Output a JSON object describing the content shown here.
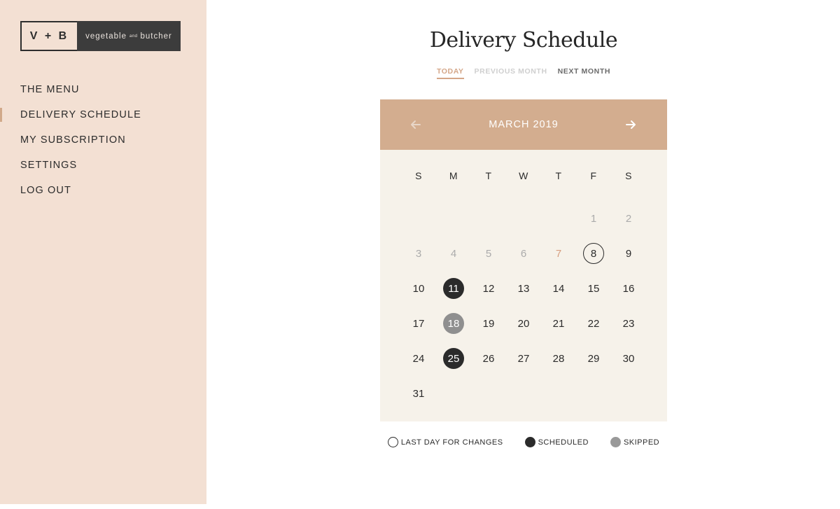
{
  "logo": {
    "mark": "V + B",
    "text_left": "vegetable",
    "text_and": "and",
    "text_right": "butcher"
  },
  "sidebar": {
    "items": [
      {
        "label": "THE MENU"
      },
      {
        "label": "DELIVERY SCHEDULE"
      },
      {
        "label": "MY SUBSCRIPTION"
      },
      {
        "label": "SETTINGS"
      },
      {
        "label": "LOG OUT"
      }
    ]
  },
  "page": {
    "title": "Delivery Schedule"
  },
  "subnav": {
    "today": "TODAY",
    "previous": "PREVIOUS MONTH",
    "next": "NEXT MONTH"
  },
  "calendar": {
    "month": "MARCH 2019",
    "prev_icon": "arrow-left-icon",
    "next_icon": "arrow-right-icon",
    "weekdays": [
      "S",
      "M",
      "T",
      "W",
      "T",
      "F",
      "S"
    ],
    "weeks": [
      [
        "",
        "",
        "",
        "",
        "",
        "1",
        "2"
      ],
      [
        "3",
        "4",
        "5",
        "6",
        "7",
        "8",
        "9"
      ],
      [
        "10",
        "11",
        "12",
        "13",
        "14",
        "15",
        "16"
      ],
      [
        "17",
        "18",
        "19",
        "20",
        "21",
        "22",
        "23"
      ],
      [
        "24",
        "25",
        "26",
        "27",
        "28",
        "29",
        "30"
      ],
      [
        "31",
        "",
        "",
        "",
        "",
        "",
        ""
      ]
    ]
  },
  "legend": {
    "last_day": "LAST DAY FOR CHANGES",
    "scheduled": "SCHEDULED",
    "skipped": "SKIPPED"
  },
  "colors": {
    "sidebar_bg": "#f3e0d3",
    "accent": "#d3ad8f",
    "calendar_bg": "#f6f2ea",
    "scheduled": "#2b2b2b",
    "skipped": "#8f8f8f",
    "today_text": "#d79f80"
  }
}
